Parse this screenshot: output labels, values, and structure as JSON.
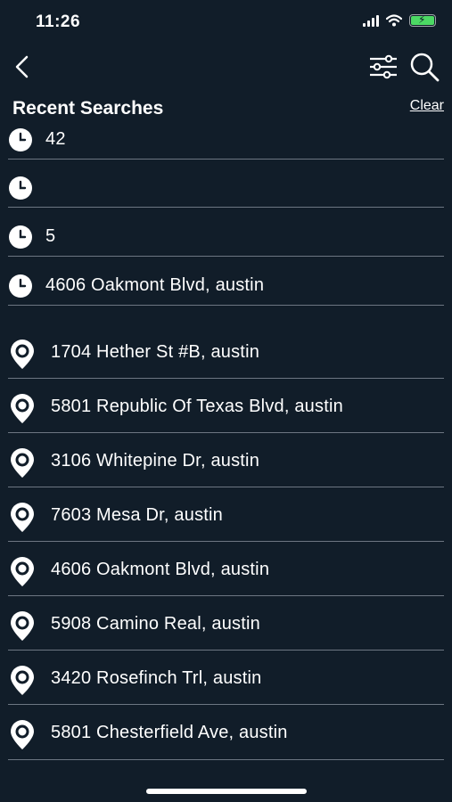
{
  "status_bar": {
    "time": "11:26"
  },
  "section": {
    "title": "Recent Searches",
    "clear_label": "Clear"
  },
  "recent_searches": [
    {
      "label": "42"
    },
    {
      "label": ""
    },
    {
      "label": "5"
    },
    {
      "label": "4606 Oakmont Blvd, austin"
    }
  ],
  "places": [
    {
      "label": "1704 Hether St #B, austin"
    },
    {
      "label": "5801 Republic Of Texas Blvd, austin"
    },
    {
      "label": "3106 Whitepine Dr, austin"
    },
    {
      "label": "7603 Mesa Dr, austin"
    },
    {
      "label": "4606 Oakmont Blvd, austin"
    },
    {
      "label": "5908 Camino Real, austin"
    },
    {
      "label": "3420 Rosefinch Trl, austin"
    },
    {
      "label": "5801 Chesterfield Ave, austin"
    }
  ],
  "colors": {
    "background": "#111d29",
    "divider": "#6d7682",
    "text": "#ffffff",
    "battery": "#4cd964"
  }
}
